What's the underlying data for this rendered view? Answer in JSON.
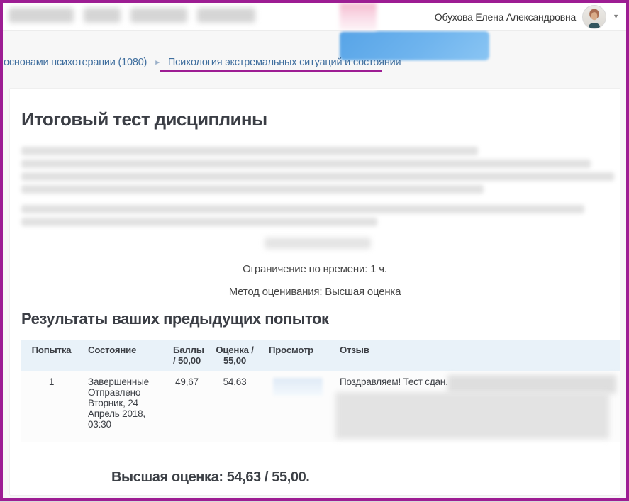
{
  "colors": {
    "accent_magenta": "#9d1d93",
    "link_blue": "#3f6e9e",
    "table_header_bg": "#e9f2f9",
    "redaction_blue": "#63aae9",
    "redaction_pink": "#f5bccf"
  },
  "topbar": {
    "user_name": "Обухова Елена Александровна"
  },
  "icons": {
    "caret_down": "▼",
    "breadcrumb_separator": "►"
  },
  "breadcrumb": {
    "previous": "основами психотерапии (1080)",
    "current": "Психология экстремальных ситуаций и состоянии"
  },
  "content": {
    "title": "Итоговый тест дисциплины",
    "time_limit": "Ограничение по времени: 1 ч.",
    "grading_method": "Метод оценивания: Высшая оценка",
    "results_heading": "Результаты ваших предыдущих попыток",
    "final_grade": "Высшая оценка: 54,63 / 55,00."
  },
  "attempts_table": {
    "headers": {
      "attempt": "Попытка",
      "state": "Состояние",
      "marks": "Баллы / 50,00",
      "grade": "Оценка / 55,00",
      "review": "Просмотр",
      "feedback": "Отзыв"
    },
    "rows": [
      {
        "attempt": "1",
        "state": "Завершенные Отправлено Вторник, 24 Апрель 2018, 03:30",
        "marks": "49,67",
        "grade": "54,63",
        "feedback": "Поздравляем! Тест сдан."
      }
    ]
  }
}
